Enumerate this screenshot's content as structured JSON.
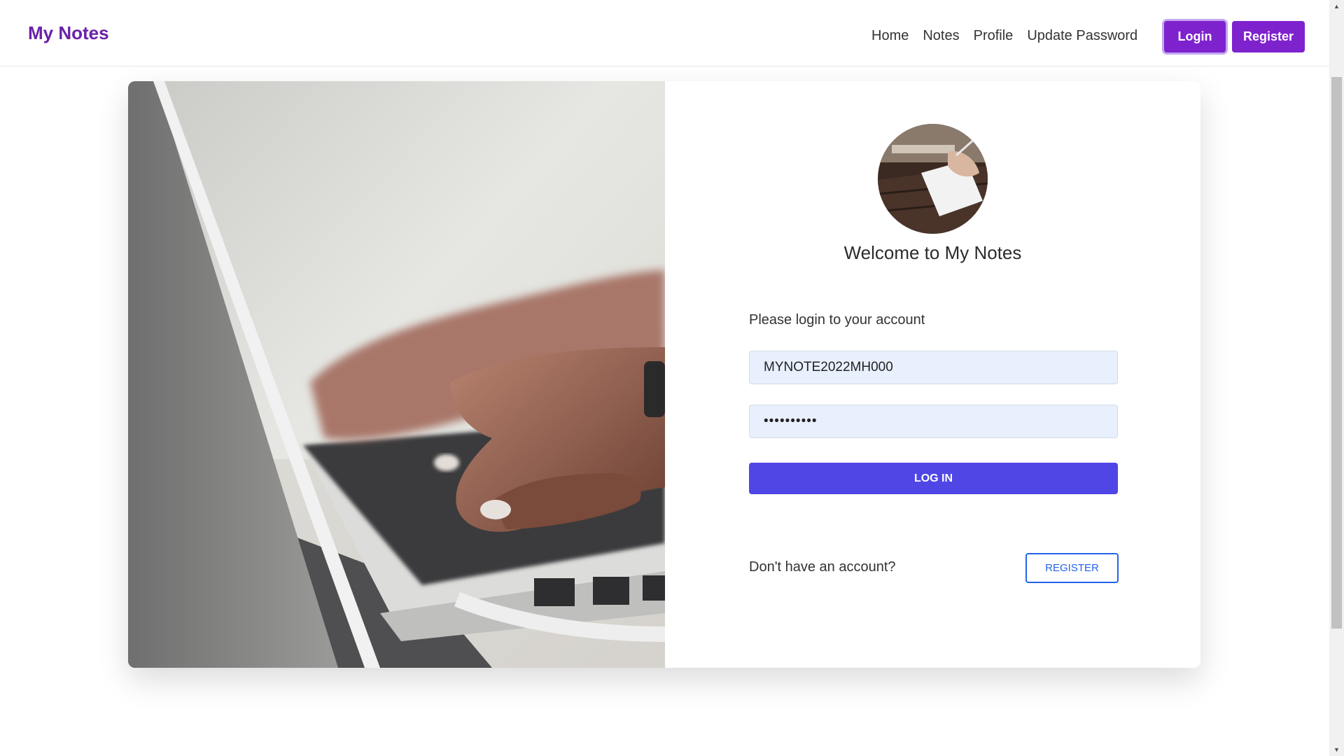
{
  "navbar": {
    "brand": "My Notes",
    "links": [
      "Home",
      "Notes",
      "Profile",
      "Update Password"
    ],
    "login_label": "Login",
    "register_label": "Register"
  },
  "login_card": {
    "welcome": "Welcome to My Notes",
    "prompt": "Please login to your account",
    "username_value": "MYNOTE2022MH000",
    "password_value": "••••••••••",
    "login_button": "LOG IN",
    "no_account_text": "Don't have an account?",
    "register_button": "REGISTER"
  },
  "colors": {
    "brand": "#6b21a8",
    "nav_button": "#7e22ce",
    "login_button": "#4f46e5",
    "register_outline": "#2563eb",
    "input_bg": "#e8f0fe"
  },
  "icons": {
    "scroll_up": "scroll-up-arrow-icon",
    "scroll_down": "scroll-down-arrow-icon"
  }
}
